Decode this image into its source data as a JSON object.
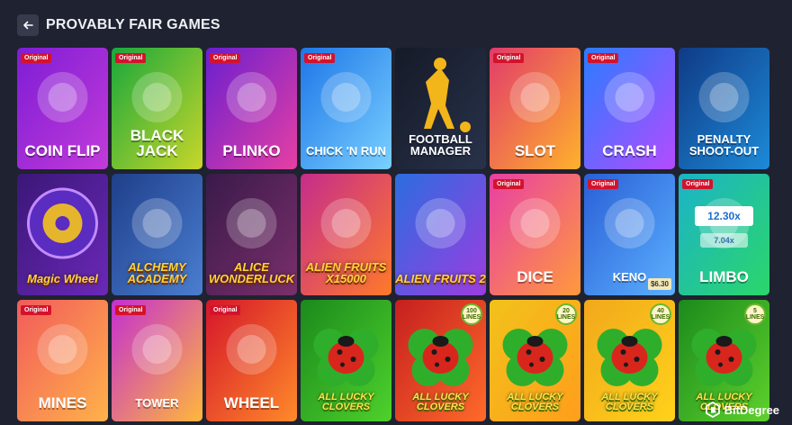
{
  "header": {
    "title": "PROVABLY FAIR GAMES"
  },
  "badge_label": "Original",
  "games": [
    {
      "name": "COIN FLIP",
      "original": true,
      "bg": [
        "#7e1dd6",
        "#c23bd8"
      ],
      "style": "big"
    },
    {
      "name": "BLACK JACK",
      "original": true,
      "bg": [
        "#18a83c",
        "#c8d62a"
      ],
      "style": "big"
    },
    {
      "name": "PLINKO",
      "original": true,
      "bg": [
        "#6a1fcf",
        "#e63fa3"
      ],
      "style": "big"
    },
    {
      "name": "CHICK 'N RUN",
      "original": true,
      "bg": [
        "#1d76e8",
        "#7ad0ff"
      ],
      "style": "mid"
    },
    {
      "name": "FOOTBALL MANAGER",
      "original": false,
      "bg": [
        "#151a28",
        "#28324a"
      ],
      "style": "dark"
    },
    {
      "name": "SLOT",
      "original": true,
      "bg": [
        "#e23b6b",
        "#ffb12c"
      ],
      "style": "big"
    },
    {
      "name": "CRASH",
      "original": true,
      "bg": [
        "#2a7cff",
        "#b44bff"
      ],
      "style": "big"
    },
    {
      "name": "PENALTY SHOOT-OUT",
      "original": false,
      "bg": [
        "#0f3a86",
        "#1d8ad8"
      ],
      "style": "mid"
    },
    {
      "name": "Magic Wheel",
      "original": false,
      "bg": [
        "#3a1777",
        "#6b28b8"
      ],
      "style": "magic"
    },
    {
      "name": "ALCHEMY ACADEMY",
      "original": false,
      "bg": [
        "#1f3f8a",
        "#4a7ed1"
      ],
      "style": "fancy"
    },
    {
      "name": "ALICE WONDERLUCK",
      "original": false,
      "bg": [
        "#3a1a4a",
        "#7a2f6b"
      ],
      "style": "fancy"
    },
    {
      "name": "ALIEN FRUITS X15000",
      "original": false,
      "bg": [
        "#c52c8c",
        "#ff7a2a"
      ],
      "style": "fancy"
    },
    {
      "name": "ALIEN FRUITS 2",
      "original": false,
      "bg": [
        "#2b6de0",
        "#9d3ce0"
      ],
      "style": "fancy"
    },
    {
      "name": "DICE",
      "original": true,
      "bg": [
        "#e83fa5",
        "#ff9a3c"
      ],
      "style": "big"
    },
    {
      "name": "KENO",
      "original": true,
      "bg": [
        "#2a5fd6",
        "#5bb0ff"
      ],
      "style": "mid",
      "price": "$6.30"
    },
    {
      "name": "LIMBO",
      "original": true,
      "bg": [
        "#1bb3c8",
        "#2bd66a"
      ],
      "style": "big",
      "multipliers": [
        "12.30x",
        "7.04x"
      ]
    },
    {
      "name": "MINES",
      "original": true,
      "bg": [
        "#f25b5b",
        "#ffb24a"
      ],
      "style": "big"
    },
    {
      "name": "TOWER",
      "original": true,
      "bg": [
        "#c42fd1",
        "#ffb83b"
      ],
      "style": "mid"
    },
    {
      "name": "WHEEL",
      "original": true,
      "bg": [
        "#d5152a",
        "#ff8a2a"
      ],
      "style": "big"
    },
    {
      "name": "ALL LUCKY CLOVERS",
      "original": false,
      "bg": [
        "#1b8a1c",
        "#4ed12c"
      ],
      "style": "green"
    },
    {
      "name": "ALL LUCKY CLOVERS",
      "original": false,
      "bg": [
        "#c51f1f",
        "#ff6a2a"
      ],
      "style": "green",
      "spins": "100 LINES"
    },
    {
      "name": "ALL LUCKY CLOVERS",
      "original": false,
      "bg": [
        "#f2c21b",
        "#ff9e1b"
      ],
      "style": "green",
      "spins": "20 LINES"
    },
    {
      "name": "ALL LUCKY CLOVERS",
      "original": false,
      "bg": [
        "#f2a81b",
        "#ffd21b"
      ],
      "style": "green",
      "spins": "40 LINES"
    },
    {
      "name": "ALL LUCKY CLOVERS",
      "original": false,
      "bg": [
        "#1b8a1c",
        "#5ed12c"
      ],
      "style": "green",
      "spins": "5 LINES"
    }
  ],
  "watermark": {
    "text": "BitDegree"
  }
}
